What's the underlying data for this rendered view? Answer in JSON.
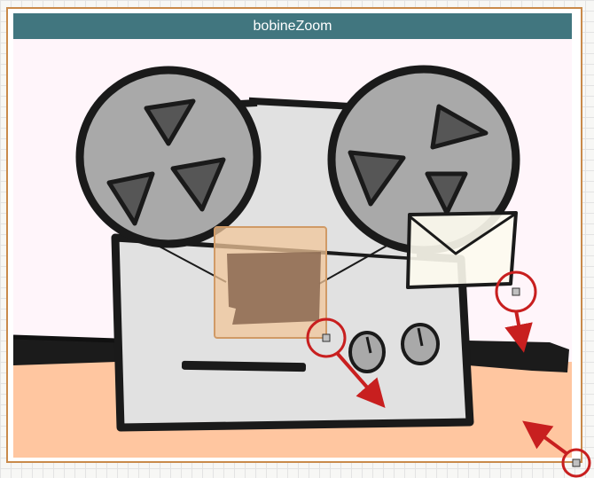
{
  "window": {
    "title": "bobineZoom"
  },
  "colors": {
    "title_bar": "#41767f",
    "frame_border": "#c98a4b",
    "scene_background": "#fff5fa",
    "floor": "#ffc6a0",
    "machine_body": "#e1e1e1",
    "reel": "#a9a9a9",
    "reel_cutout": "#565656",
    "selection_box": "#f0c69a",
    "envelope": "#fdfbee",
    "annotation_red": "#c81f1f"
  },
  "icons": [
    "tape-recorder-illustration",
    "left-reel-icon",
    "right-reel-icon",
    "envelope-icon",
    "control-knob-icon",
    "resize-handle-icon",
    "direction-arrow-icon"
  ]
}
